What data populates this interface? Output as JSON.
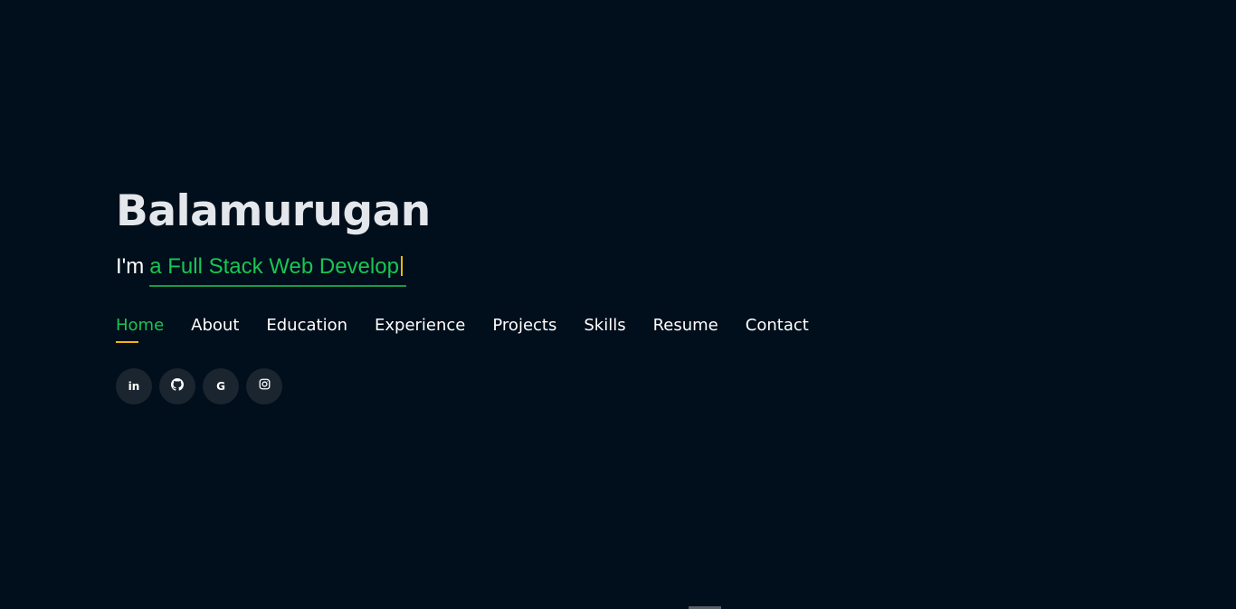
{
  "hero": {
    "name": "Balamurugan",
    "tagline_prefix": "I'm",
    "typed_text": "a Full Stack Web Develop"
  },
  "nav": {
    "items": [
      {
        "label": "Home",
        "active": true
      },
      {
        "label": "About"
      },
      {
        "label": "Education"
      },
      {
        "label": "Experience"
      },
      {
        "label": "Projects"
      },
      {
        "label": "Skills"
      },
      {
        "label": "Resume"
      },
      {
        "label": "Contact"
      }
    ]
  },
  "social": {
    "linkedin_text": "in",
    "google_text": "G",
    "icons": [
      "linkedin-icon",
      "github-icon",
      "google-icon",
      "instagram-icon"
    ]
  },
  "colors": {
    "background": "#010e1b",
    "accent_green": "#18c653",
    "accent_yellow": "#f2b705",
    "social_bg": "#1b2530"
  }
}
